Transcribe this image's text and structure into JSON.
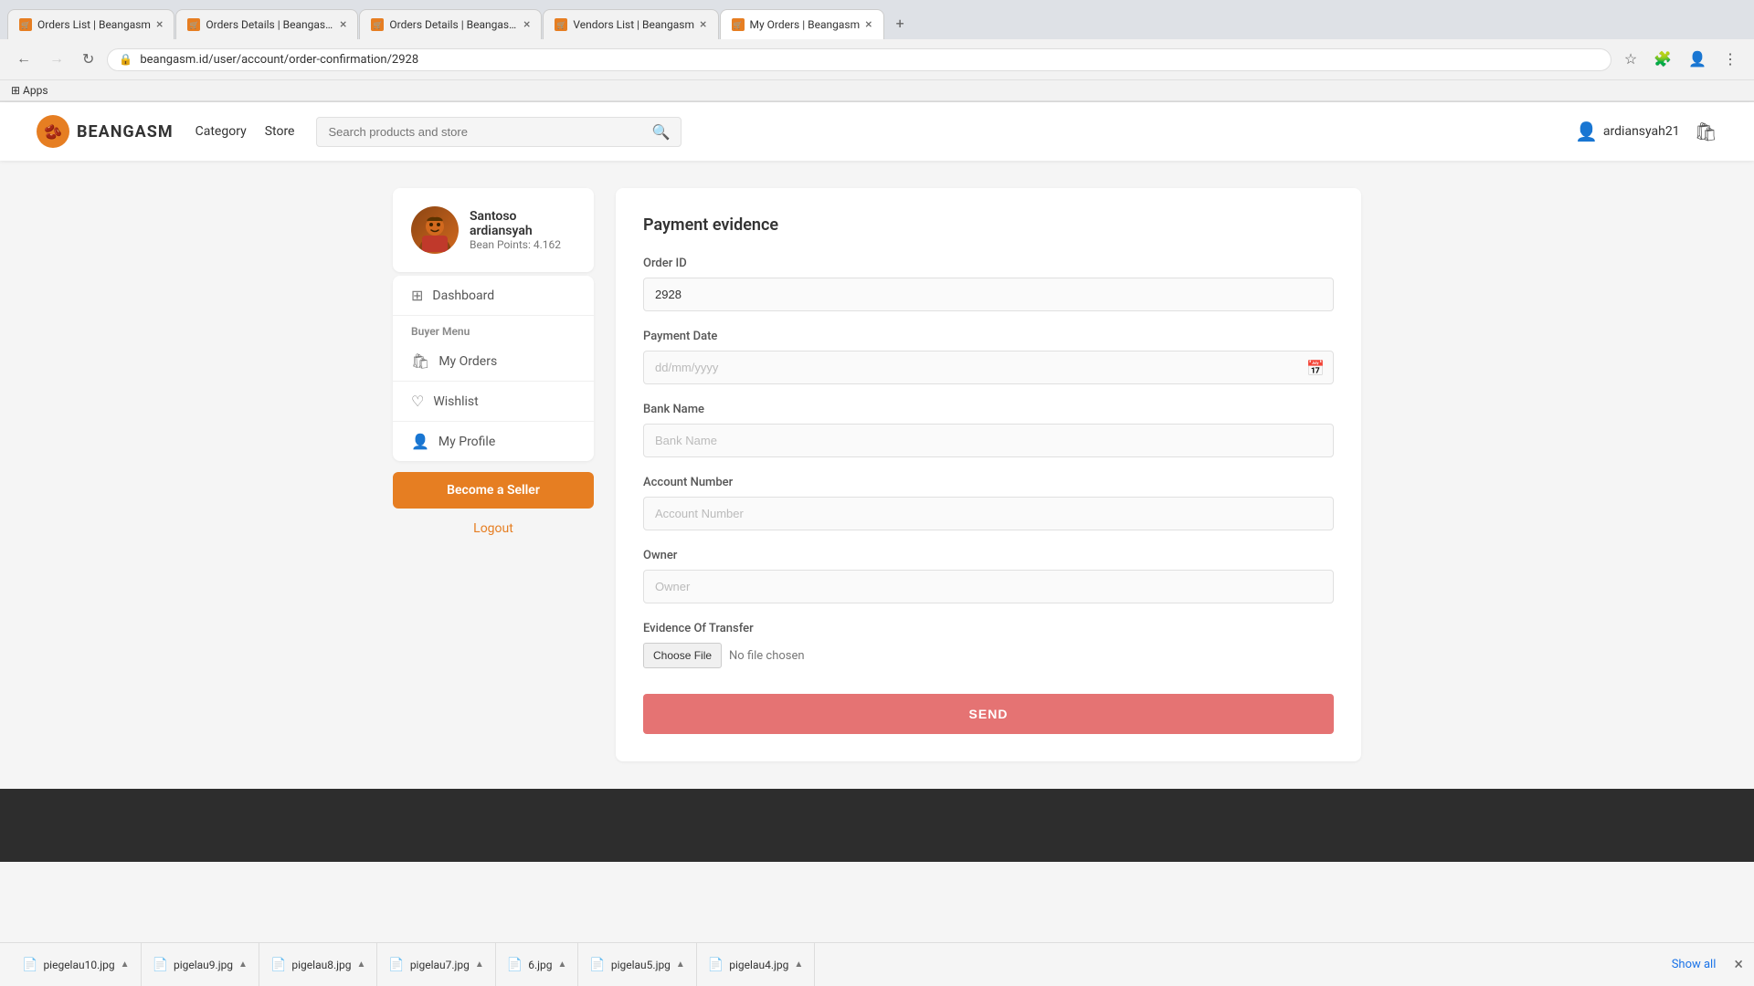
{
  "browser": {
    "tabs": [
      {
        "id": "tab1",
        "title": "Orders List | Beangasm",
        "active": false,
        "favicon": "🛒"
      },
      {
        "id": "tab2",
        "title": "Orders Details | Beangasm",
        "active": false,
        "favicon": "🛒"
      },
      {
        "id": "tab3",
        "title": "Orders Details | Beangasm",
        "active": false,
        "favicon": "🛒"
      },
      {
        "id": "tab4",
        "title": "Vendors List | Beangasm",
        "active": false,
        "favicon": "🛒"
      },
      {
        "id": "tab5",
        "title": "My Orders | Beangasm",
        "active": true,
        "favicon": "🛒"
      }
    ],
    "url": "beangasm.id/user/account/order-confirmation/2928",
    "back_disabled": false,
    "forward_disabled": true
  },
  "navbar": {
    "logo_text": "BEANGASM",
    "links": [
      "Category",
      "Store"
    ],
    "search_placeholder": "Search products and store",
    "username": "ardiansyah21"
  },
  "sidebar": {
    "profile_name": "Santoso ardiansyah",
    "profile_points": "Bean Points: 4.162",
    "dashboard_label": "Dashboard",
    "buyer_menu_label": "Buyer Menu",
    "my_orders_label": "My Orders",
    "wishlist_label": "Wishlist",
    "my_profile_label": "My Profile",
    "become_seller_label": "Become a Seller",
    "logout_label": "Logout"
  },
  "form": {
    "title": "Payment evidence",
    "order_id_label": "Order ID",
    "order_id_value": "2928",
    "payment_date_label": "Payment Date",
    "payment_date_placeholder": "dd/mm/yyyy",
    "bank_name_label": "Bank Name",
    "bank_name_placeholder": "Bank Name",
    "account_number_label": "Account Number",
    "account_number_placeholder": "Account Number",
    "owner_label": "Owner",
    "owner_placeholder": "Owner",
    "evidence_label": "Evidence Of Transfer",
    "choose_file_label": "Choose File",
    "no_file_text": "No file chosen",
    "send_button_label": "SEND"
  },
  "downloads": {
    "items": [
      {
        "name": "piegelau10.jpg"
      },
      {
        "name": "pigelau9.jpg"
      },
      {
        "name": "pigelau8.jpg"
      },
      {
        "name": "pigelau7.jpg"
      },
      {
        "name": "6.jpg"
      },
      {
        "name": "pigelau5.jpg"
      },
      {
        "name": "pigelau4.jpg"
      }
    ],
    "show_all_label": "Show all"
  }
}
